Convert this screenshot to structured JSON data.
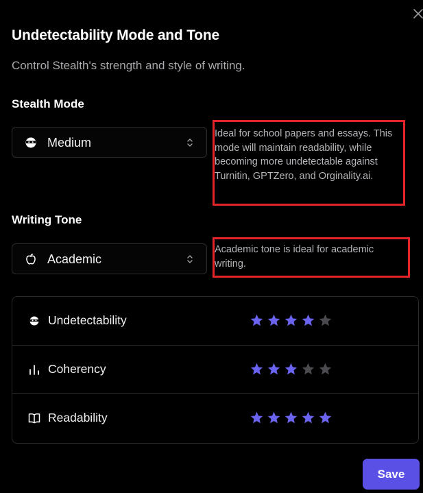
{
  "dialog": {
    "title": "Undetectability Mode and Tone",
    "subtitle": "Control Stealth's strength and style of writing."
  },
  "stealth_mode": {
    "label": "Stealth Mode",
    "selected": "Medium",
    "icon": "ninja-icon",
    "description": "Ideal for school papers and essays. This mode will maintain readability, while becoming more undetectable against Turnitin, GPTZero, and Orginality.ai."
  },
  "writing_tone": {
    "label": "Writing Tone",
    "selected": "Academic",
    "icon": "apple-icon",
    "description": "Academic tone is ideal for academic writing."
  },
  "ratings": [
    {
      "label": "Undetectability",
      "icon": "ninja-icon",
      "stars": 4,
      "max": 5
    },
    {
      "label": "Coherency",
      "icon": "bar-chart-icon",
      "stars": 3,
      "max": 5
    },
    {
      "label": "Readability",
      "icon": "book-open-icon",
      "stars": 5,
      "max": 5
    }
  ],
  "actions": {
    "save_label": "Save"
  },
  "colors": {
    "accent": "#5b50e6",
    "star_filled": "#6a63f0",
    "star_empty": "#4a4a4f",
    "highlight_box": "#e3252a"
  }
}
